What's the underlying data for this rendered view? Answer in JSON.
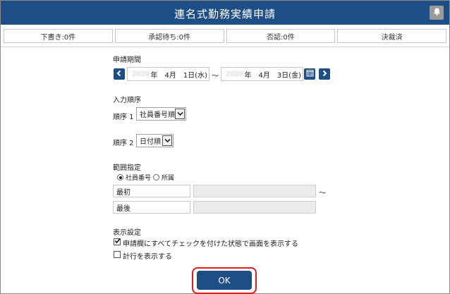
{
  "header": {
    "title": "連名式勤務実績申請",
    "bell_icon": "bell-icon"
  },
  "tabs": [
    {
      "label": "下書き:0件"
    },
    {
      "label": "承認待ち:0件"
    },
    {
      "label": "否認:0件"
    },
    {
      "label": "決裁済"
    }
  ],
  "period": {
    "label": "申請期間",
    "start": {
      "year": "2020",
      "rest": "年　4月　1日(水)"
    },
    "separator": "～",
    "end": {
      "year": "2020",
      "rest": "年　4月　3日(金)"
    }
  },
  "order": {
    "label": "入力順序",
    "order1": {
      "label": "順序 1",
      "value": "社員番号順"
    },
    "order2": {
      "label": "順序 2",
      "value": "日付順"
    }
  },
  "range": {
    "label": "範囲指定",
    "radio_employee": "社員番号",
    "radio_department": "所属",
    "first": "最初",
    "last": "最後",
    "tilde": "～"
  },
  "display": {
    "label": "表示設定",
    "check_all_label": "申請欄にすべてチェックを付けた状態で画面を表示する",
    "show_planned_label": "計行を表示する"
  },
  "ok_label": "OK",
  "colors": {
    "header": "#1d4f86",
    "highlight": "#e11b1b"
  }
}
